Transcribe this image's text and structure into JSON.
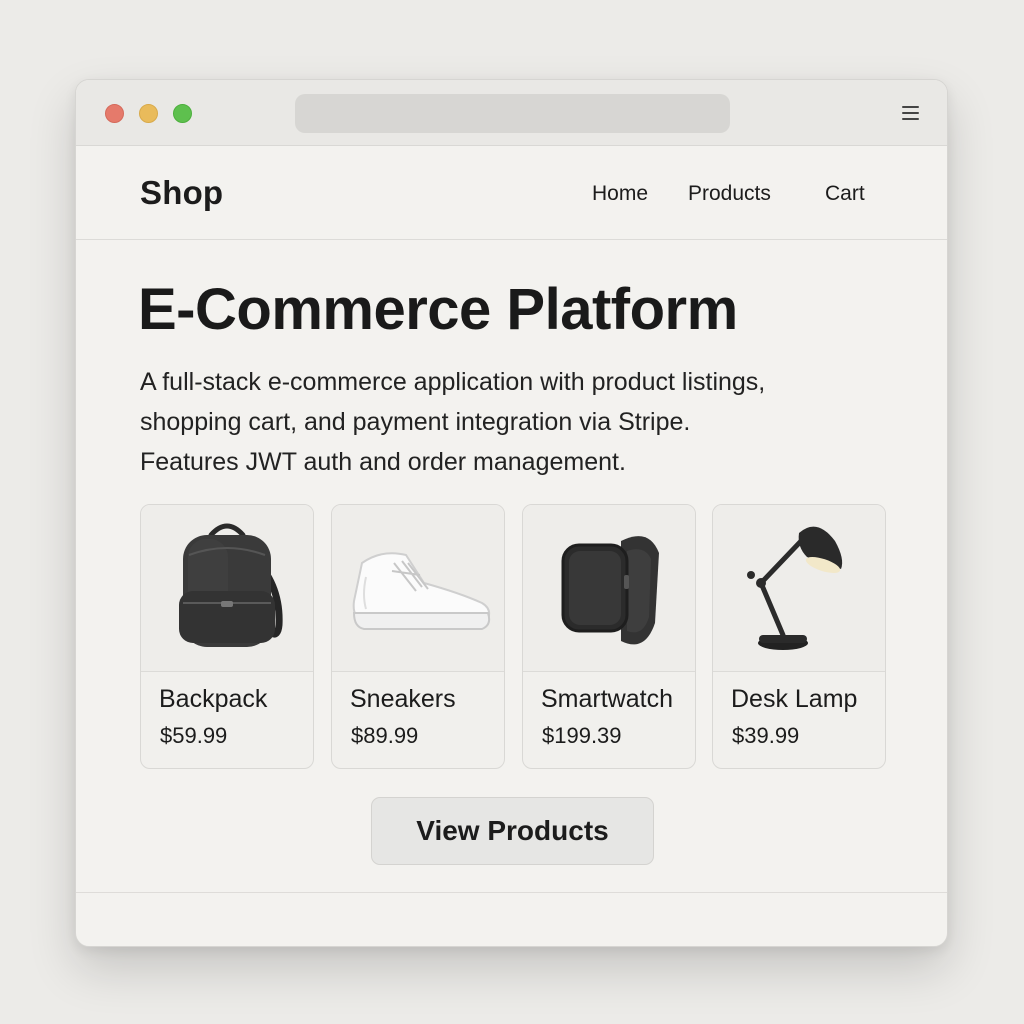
{
  "window": {
    "controls": [
      "close-dot",
      "minimize-dot",
      "maximize-dot"
    ],
    "menu_icon": "hamburger-menu-icon"
  },
  "nav": {
    "brand": "Shop",
    "links": [
      "Home",
      "Products",
      "Cart"
    ]
  },
  "hero": {
    "title": "E-Commerce Platform",
    "description_lines": [
      "A full-stack e-commerce application with product listings,",
      "shopping cart, and payment integration via Stripe.",
      "Features JWT auth and order management."
    ]
  },
  "products": [
    {
      "name": "Backpack",
      "price": "$59.99",
      "icon": "backpack-icon"
    },
    {
      "name": "Sneakers",
      "price": "$89.99",
      "icon": "sneaker-icon"
    },
    {
      "name": "Smartwatch",
      "price": "$199.39",
      "icon": "smartwatch-icon"
    },
    {
      "name": "Desk Lamp",
      "price": "$39.99",
      "icon": "desk-lamp-icon"
    }
  ],
  "cta": {
    "label": "View Products"
  },
  "colors": {
    "background": "#ecebe8",
    "window": "#f3f2ef",
    "text": "#1d1d1d",
    "dot_red": "#e57a6b",
    "dot_yellow": "#e9bb5b",
    "dot_green": "#5ec04e"
  }
}
